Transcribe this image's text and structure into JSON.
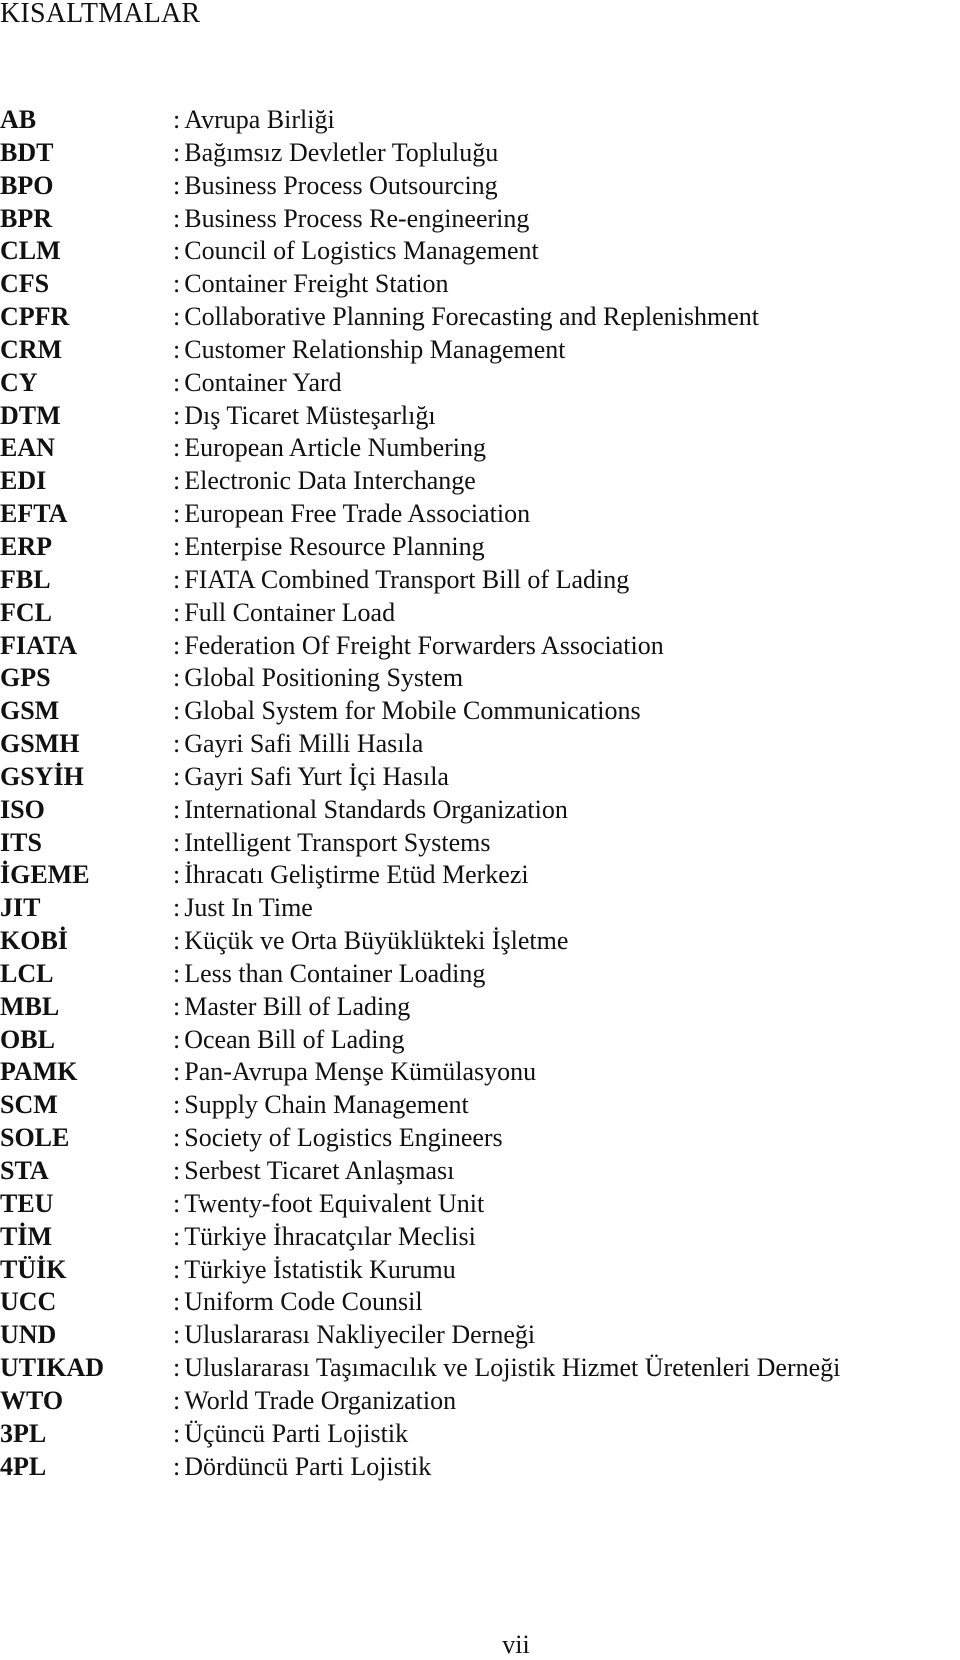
{
  "page": {
    "title": "KISALTMALAR",
    "separator": ":",
    "page_number": "vii"
  },
  "abbreviations": [
    {
      "code": "AB",
      "description": "Avrupa Birliği"
    },
    {
      "code": "BDT",
      "description": "Bağımsız Devletler Topluluğu"
    },
    {
      "code": "BPO",
      "description": "Business Process Outsourcing"
    },
    {
      "code": "BPR",
      "description": "Business Process Re-engineering"
    },
    {
      "code": "CLM",
      "description": "Council of Logistics Management"
    },
    {
      "code": "CFS",
      "description": "Container Freight Station"
    },
    {
      "code": "CPFR",
      "description": "Collaborative Planning Forecasting and Replenishment"
    },
    {
      "code": "CRM",
      "description": "Customer Relationship Management"
    },
    {
      "code": "CY",
      "description": "Container Yard"
    },
    {
      "code": "DTM",
      "description": "Dış Ticaret Müsteşarlığı"
    },
    {
      "code": "EAN",
      "description": "European Article Numbering"
    },
    {
      "code": "EDI",
      "description": "Electronic Data Interchange"
    },
    {
      "code": "EFTA",
      "description": "European Free Trade Association"
    },
    {
      "code": "ERP",
      "description": "Enterpise Resource Planning"
    },
    {
      "code": "FBL",
      "description": "FIATA Combined Transport Bill of Lading"
    },
    {
      "code": "FCL",
      "description": "Full Container Load"
    },
    {
      "code": "FIATA",
      "description": "Federation Of Freight Forwarders Association"
    },
    {
      "code": "GPS",
      "description": "Global Positioning System"
    },
    {
      "code": "GSM",
      "description": "Global System for Mobile Communications"
    },
    {
      "code": "GSMH",
      "description": "Gayri Safi Milli Hasıla"
    },
    {
      "code": "GSYİH",
      "description": "Gayri Safi Yurt İçi Hasıla"
    },
    {
      "code": "ISO",
      "description": "International Standards Organization"
    },
    {
      "code": "ITS",
      "description": "Intelligent Transport Systems"
    },
    {
      "code": "İGEME",
      "description": "İhracatı Geliştirme Etüd Merkezi"
    },
    {
      "code": "JIT",
      "description": "Just In Time"
    },
    {
      "code": "KOBİ",
      "description": "Küçük ve Orta Büyüklükteki İşletme"
    },
    {
      "code": "LCL",
      "description": "Less than Container Loading"
    },
    {
      "code": "MBL",
      "description": "Master Bill of Lading"
    },
    {
      "code": "OBL",
      "description": "Ocean Bill of Lading"
    },
    {
      "code": "PAMK",
      "description": "Pan-Avrupa Menşe Kümülasyonu"
    },
    {
      "code": "SCM",
      "description": "Supply Chain Management"
    },
    {
      "code": "SOLE",
      "description": "Society of Logistics Engineers"
    },
    {
      "code": "STA",
      "description": "Serbest Ticaret Anlaşması"
    },
    {
      "code": "TEU",
      "description": "Twenty-foot Equivalent Unit"
    },
    {
      "code": "TİM",
      "description": "Türkiye İhracatçılar Meclisi"
    },
    {
      "code": "TÜİK",
      "description": "Türkiye İstatistik Kurumu"
    },
    {
      "code": "UCC",
      "description": "Uniform Code Counsil"
    },
    {
      "code": "UND",
      "description": "Uluslararası Nakliyeciler Derneği"
    },
    {
      "code": "UTIKAD",
      "description": "Uluslararası Taşımacılık ve Lojistik Hizmet Üretenleri Derneği"
    },
    {
      "code": "WTO",
      "description": "World Trade Organization"
    },
    {
      "code": "3PL",
      "description": "Üçüncü Parti Lojistik"
    },
    {
      "code": "4PL",
      "description": "Dördüncü Parti Lojistik"
    }
  ]
}
